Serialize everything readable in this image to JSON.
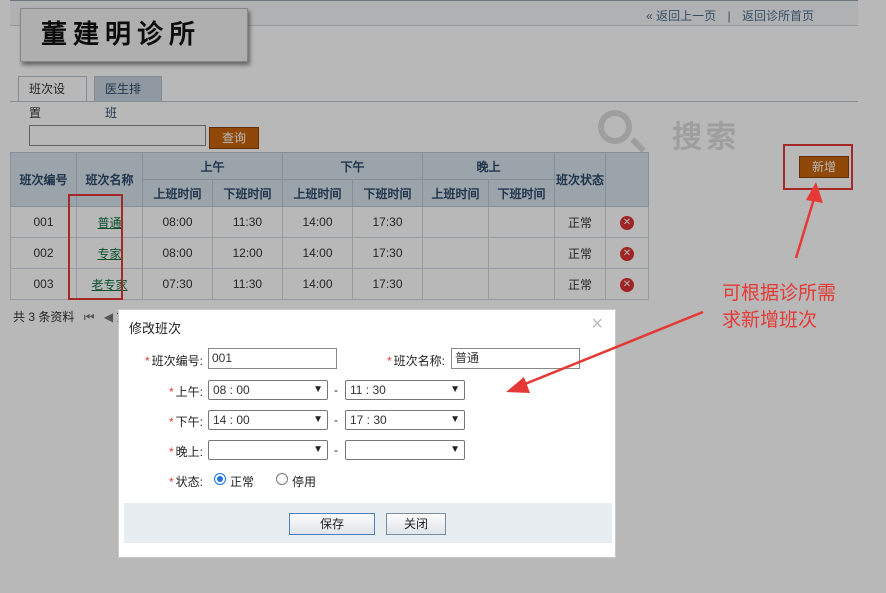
{
  "header": {
    "logo_text": "董建明诊所",
    "back_link": "« 返回上一页",
    "separator": "|",
    "home_link": "返回诊所首页"
  },
  "tabs": [
    {
      "label": "班次设置",
      "active": true
    },
    {
      "label": "医生排班",
      "active": false
    }
  ],
  "search": {
    "value": "",
    "button_label": "查询",
    "watermark_text": "搜索"
  },
  "toolbar": {
    "add_label": "新增"
  },
  "table": {
    "headers": {
      "code": "班次编号",
      "name": "班次名称",
      "morning": "上午",
      "afternoon": "下午",
      "evening": "晚上",
      "status": "班次状态",
      "start": "上班时间",
      "end": "下班时间"
    },
    "rows": [
      {
        "code": "001",
        "name": "普通",
        "am_start": "08:00",
        "am_end": "11:30",
        "pm_start": "14:00",
        "pm_end": "17:30",
        "ev_start": "",
        "ev_end": "",
        "status": "正常"
      },
      {
        "code": "002",
        "name": "专家",
        "am_start": "08:00",
        "am_end": "12:00",
        "pm_start": "14:00",
        "pm_end": "17:30",
        "ev_start": "",
        "ev_end": "",
        "status": "正常"
      },
      {
        "code": "003",
        "name": "老专家",
        "am_start": "07:30",
        "am_end": "11:30",
        "pm_start": "14:00",
        "pm_end": "17:30",
        "ev_start": "",
        "ev_end": "",
        "status": "正常"
      }
    ]
  },
  "pager": {
    "summary": "共 3 条资料",
    "first_icon": "first-page-icon",
    "prev_icon": "prev-page-icon",
    "page_prefix": "第"
  },
  "dialog": {
    "title": "修改班次",
    "close_glyph": "×",
    "required_mark": "*",
    "code_label": "班次编号:",
    "code_value": "001",
    "name_label": "班次名称:",
    "name_value": "普通",
    "morning_label": "上午:",
    "morning_start": "08 : 00",
    "morning_end": "11 : 30",
    "afternoon_label": "下午:",
    "afternoon_start": "14 : 00",
    "afternoon_end": "17 : 30",
    "evening_label": "晚上:",
    "evening_start": "",
    "evening_end": "",
    "range_sep": "-",
    "status_label": "状态:",
    "status_options": [
      "正常",
      "停用"
    ],
    "status_selected": "正常",
    "save_label": "保存",
    "close_label": "关闭"
  },
  "annotation": {
    "line1": "可根据诊所需",
    "line2": "求新增班次",
    "color": "#e53935"
  },
  "colors": {
    "accent_button": "#c8640c",
    "header_bg": "#d7e2ee",
    "link_green": "#0d6f3e",
    "delete_red": "#d33"
  }
}
